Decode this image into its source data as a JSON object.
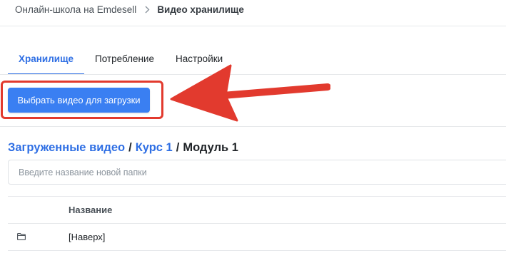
{
  "breadcrumb": {
    "parent": "Онлайн-школа на Emdesell",
    "current": "Видео хранилище"
  },
  "tabs": [
    {
      "label": "Хранилище",
      "active": true
    },
    {
      "label": "Потребление",
      "active": false
    },
    {
      "label": "Настройки",
      "active": false
    }
  ],
  "upload_button": {
    "label": "Выбрать видео для загрузки"
  },
  "path": {
    "root": "Загруженные видео",
    "separator": "/",
    "course": "Курс 1",
    "module": "Модуль 1"
  },
  "folder_input": {
    "placeholder": "Введите название новой папки",
    "value": ""
  },
  "table": {
    "header": {
      "name": "Название"
    },
    "rows": [
      {
        "icon": "folder-icon",
        "name": "[Наверх]"
      }
    ]
  },
  "colors": {
    "accent": "#2f6fe4",
    "button": "#3a7ff2",
    "annotation": "#e23a2e"
  }
}
